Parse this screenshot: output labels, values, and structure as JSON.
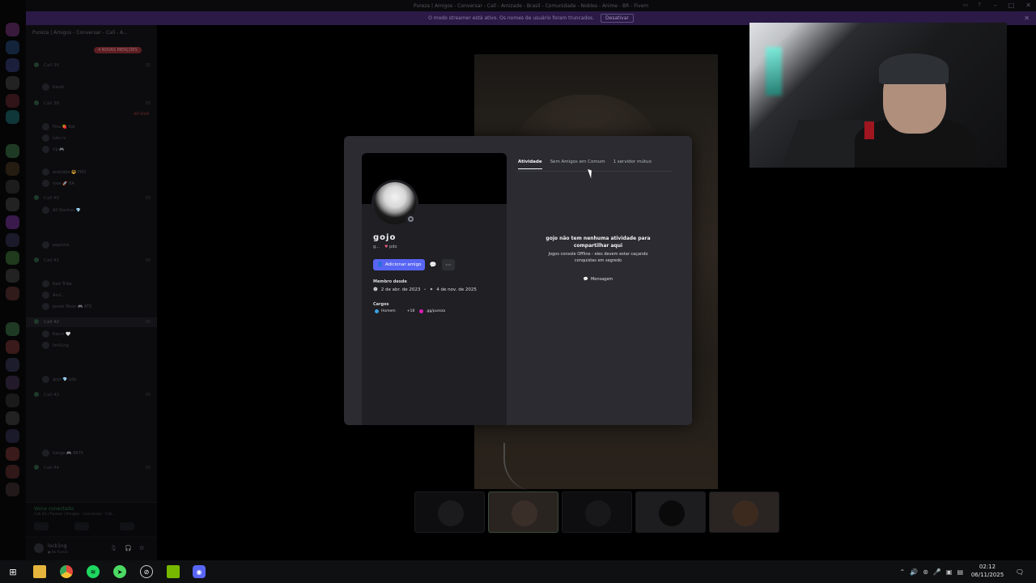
{
  "window": {
    "title": "Pureza | Amigos - Conversar - Call - Amizade - Brasil - Comunidade - Nobles - Anime - BR - Fivem"
  },
  "notice": {
    "text": "O modo streamer está ativo. Os nomes de usuário foram truncados.",
    "button": "Desativar"
  },
  "sidebar": {
    "server_name": "Pureza | Amigos - Conversar - Call - A...",
    "new_mentions": "4 NOVAS MENÇÕES",
    "live_label": "AO VIVO",
    "channels": [
      {
        "label": "Call 36",
        "badge": "05"
      },
      {
        "label": "Call 38",
        "badge": "05"
      },
      {
        "label": "Call 40",
        "badge": "05"
      },
      {
        "label": "Call 41",
        "badge": "05"
      },
      {
        "label": "Call 42",
        "badge": "05"
      },
      {
        "label": "Call 43",
        "badge": "05"
      },
      {
        "label": "Call 44",
        "badge": "05"
      }
    ],
    "members": [
      {
        "name": "Kandi"
      },
      {
        "name": "Fina 🍓 Kat"
      },
      {
        "name": "tobi.rv"
      },
      {
        "name": "rip 🎮"
      },
      {
        "name": "aneliabe 🔱 PRO"
      },
      {
        "name": "rose 🚀 BA"
      },
      {
        "name": "All Stanton 💎"
      },
      {
        "name": "pepinha"
      },
      {
        "name": "Kazi Tribe"
      },
      {
        "name": "Azul.."
      },
      {
        "name": "Jessie Moon 🎮 ATX"
      },
      {
        "name": "Raum 🤍"
      },
      {
        "name": "lock1ng"
      },
      {
        "name": "gojo 💎 pdo"
      },
      {
        "name": "tiengo 🎮 8875"
      }
    ]
  },
  "voice": {
    "status": "Voice conectado",
    "channel": "Call 42 / Pureza | Amigos - Conversar - Call..."
  },
  "user": {
    "name": "lock1ng",
    "status": "● Na Pureza"
  },
  "profile": {
    "name": "gojo",
    "tag_prefix": "g...",
    "tag_badge": "pdo",
    "add_friend_label": "Adicionar amigo",
    "member_since_label": "Membro desde",
    "date_discord": "2 de abr. de 2023",
    "date_server": "4 de nov. de 2025",
    "roles_label": "Cargos",
    "roles": [
      {
        "name": "Homem",
        "color": "#3ba3e0"
      },
      {
        "name": "+18",
        "color": "#202225"
      },
      {
        "name": ".gg/pureza",
        "color": "#e01cb6"
      }
    ],
    "tabs": [
      "Atividade",
      "Sem Amigos em Comum",
      "1 servidor mútuo"
    ],
    "empty_title": "gojo não tem nenhuma atividade para compartilhar aqui",
    "empty_sub": "Jogos console Offline - eles devem estar caçando conquistas em segredo",
    "message_button": "Mensagem"
  },
  "taskbar": {
    "time": "02:12",
    "date": "06/11/2025"
  },
  "colors": {
    "accent": "#5865f2",
    "notice_bg": "#2b1946",
    "modal_bg": "#2b2b31"
  }
}
